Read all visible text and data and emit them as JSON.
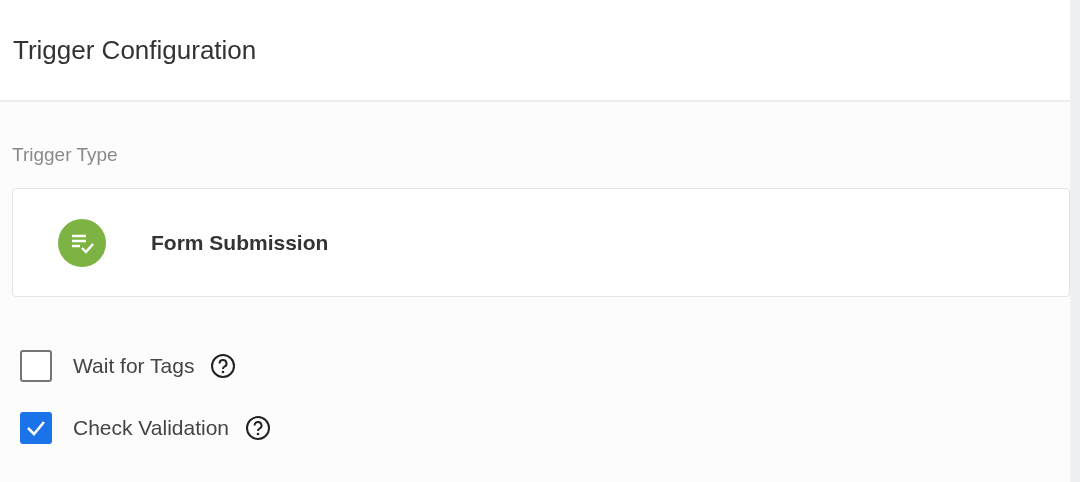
{
  "panel": {
    "title": "Trigger Configuration"
  },
  "trigger_type": {
    "label": "Trigger Type",
    "value": "Form Submission"
  },
  "options": [
    {
      "label": "Wait for Tags",
      "checked": false
    },
    {
      "label": "Check Validation",
      "checked": true
    }
  ]
}
